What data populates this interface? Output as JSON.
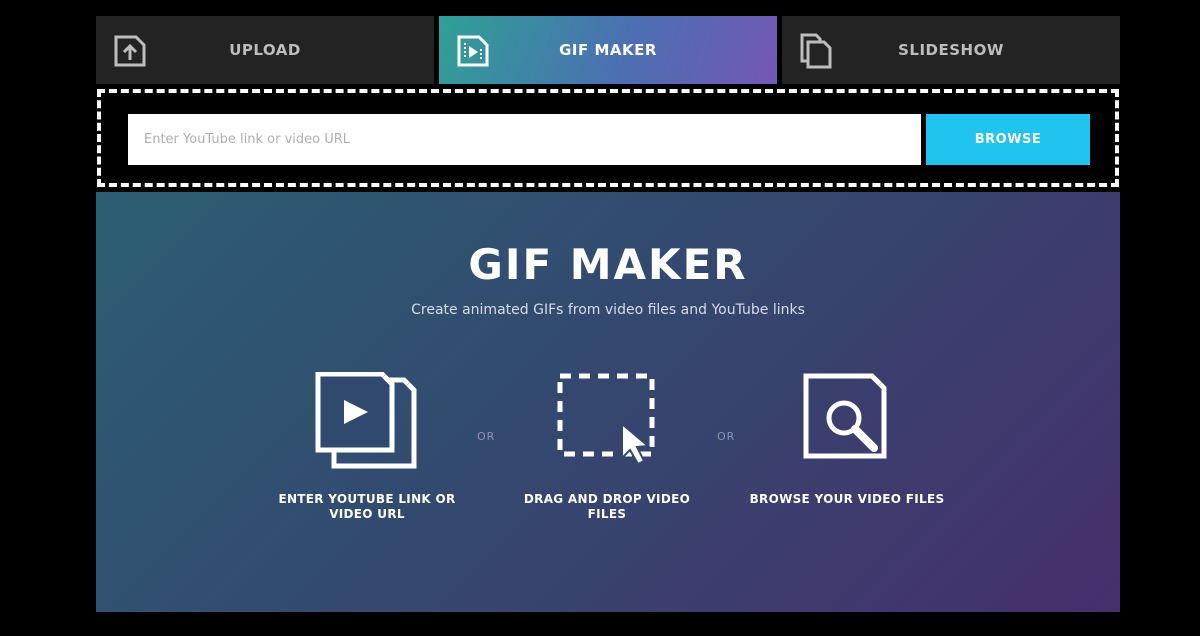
{
  "tabs": {
    "upload": {
      "label": "UPLOAD",
      "icon": "upload-icon"
    },
    "gif_maker": {
      "label": "GIF MAKER",
      "icon": "video-file-icon",
      "active": true
    },
    "slideshow": {
      "label": "SLIDESHOW",
      "icon": "documents-icon"
    }
  },
  "url_bar": {
    "placeholder": "Enter YouTube link or video URL",
    "value": "",
    "browse_label": "BROWSE"
  },
  "main": {
    "title": "GIF MAKER",
    "subtitle": "Create animated GIFs from video files and YouTube links",
    "separator": "OR",
    "options": [
      {
        "label": "ENTER YOUTUBE LINK OR VIDEO URL",
        "icon": "youtube-link-icon"
      },
      {
        "label": "DRAG AND DROP VIDEO FILES",
        "icon": "drag-drop-icon"
      },
      {
        "label": "BROWSE YOUR VIDEO FILES",
        "icon": "browse-files-icon"
      }
    ]
  },
  "colors": {
    "accent": "#21c4ee",
    "tab_background": "#232323",
    "panel_gradient_start": "#2b5f73",
    "panel_gradient_end": "#462f6d"
  }
}
